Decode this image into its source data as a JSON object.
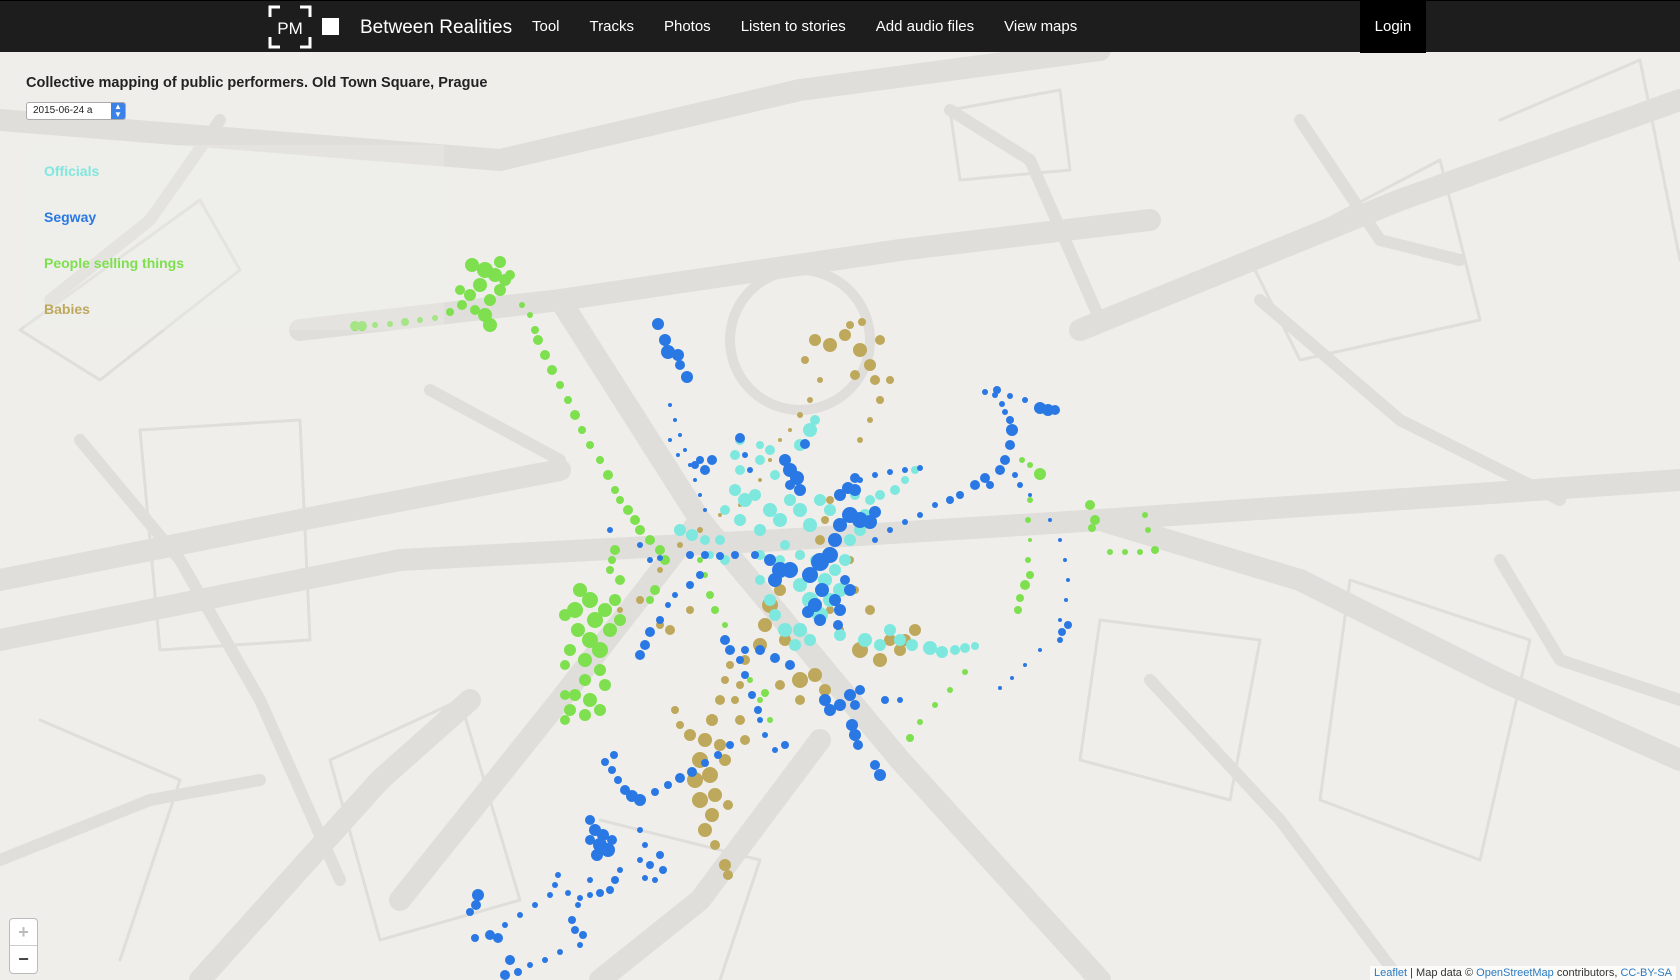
{
  "header": {
    "brand_initials": "PM",
    "brand_title": "Between Realities",
    "nav": [
      "Tool",
      "Tracks",
      "Photos",
      "Listen to stories",
      "Add audio files",
      "View maps"
    ],
    "login": "Login"
  },
  "map": {
    "title": "Collective mapping of public performers. Old Town Square, Prague",
    "date_value": "2015-06-24 a",
    "legend": [
      {
        "label": "Officials",
        "color": "#7ee8de",
        "icon": "legend-officials"
      },
      {
        "label": "Segway",
        "color": "#2a78e4",
        "icon": "legend-segway"
      },
      {
        "label": "People selling things",
        "color": "#7ee04f",
        "icon": "legend-selling"
      },
      {
        "label": "Babies",
        "color": "#bea85c",
        "icon": "legend-babies"
      }
    ],
    "zoom_in": "+",
    "zoom_out": "−",
    "attribution": {
      "leaflet": "Leaflet",
      "sep1": " | Map data © ",
      "osm": "OpenStreetMap",
      "sep2": " contributors, ",
      "license": "CC-BY-SA"
    }
  },
  "colors": {
    "officials": "#7ee8de",
    "segway": "#2a78e4",
    "selling": "#7ee04f",
    "babies": "#bea85c"
  }
}
